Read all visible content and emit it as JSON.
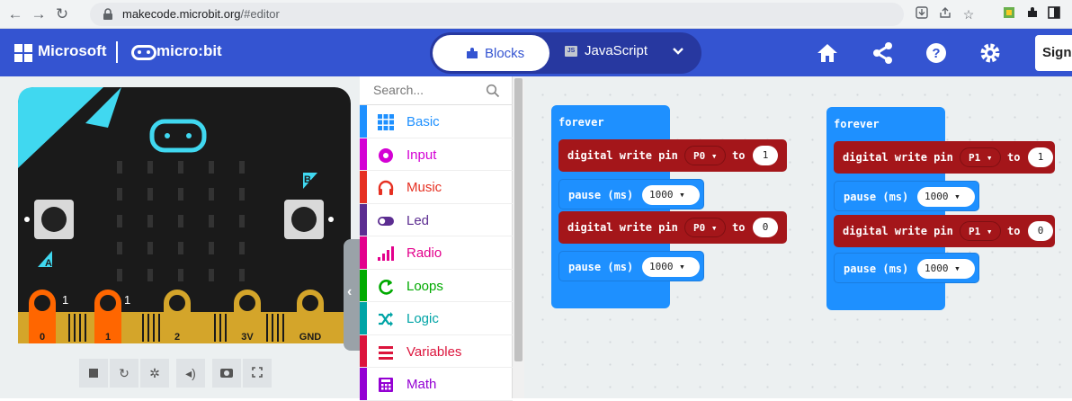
{
  "browser": {
    "url_domain": "makecode.microbit.org",
    "url_path": "/#editor",
    "icons": [
      "back-arrow-icon",
      "forward-arrow-icon",
      "reload-icon",
      "lock-icon",
      "install-icon",
      "share-icon",
      "star-icon",
      "extension-icon",
      "puzzle-icon",
      "sidebar-icon"
    ]
  },
  "header": {
    "brand": "Microsoft",
    "product": "micro:bit",
    "tabs": {
      "blocks": "Blocks",
      "javascript": "JavaScript",
      "js_badge": "JS"
    },
    "icons": [
      "home-icon",
      "share-icon",
      "help-icon",
      "settings-icon"
    ],
    "sign_in": "Sign"
  },
  "simulator": {
    "pins": [
      "0",
      "1",
      "2",
      "3V",
      "GND"
    ],
    "pin_values": [
      "1",
      "1"
    ],
    "button_labels": [
      "A",
      "B"
    ],
    "toolbar_icons": [
      "stop-icon",
      "restart-icon",
      "debug-icon",
      "mute-icon",
      "screenshot-icon",
      "fullscreen-icon"
    ]
  },
  "toolbox": {
    "search_placeholder": "Search...",
    "categories": [
      {
        "label": "Basic",
        "color": "#1e90ff"
      },
      {
        "label": "Input",
        "color": "#d400d4"
      },
      {
        "label": "Music",
        "color": "#e63022"
      },
      {
        "label": "Led",
        "color": "#5c2d91"
      },
      {
        "label": "Radio",
        "color": "#e3008c"
      },
      {
        "label": "Loops",
        "color": "#00aa00"
      },
      {
        "label": "Logic",
        "color": "#00a4a6"
      },
      {
        "label": "Variables",
        "color": "#dc143c"
      },
      {
        "label": "Math",
        "color": "#9400d3"
      }
    ]
  },
  "workspace": {
    "scripts": [
      {
        "event": "forever",
        "blocks": [
          {
            "text": "digital write pin",
            "pin": "P0 ▾",
            "to": "to",
            "value": "1"
          },
          {
            "text": "pause (ms)",
            "value": "1000 ▾"
          },
          {
            "text": "digital write pin",
            "pin": "P0 ▾",
            "to": "to",
            "value": "0"
          },
          {
            "text": "pause (ms)",
            "value": "1000 ▾"
          }
        ]
      },
      {
        "event": "forever",
        "blocks": [
          {
            "text": "digital write pin",
            "pin": "P1 ▾",
            "to": "to",
            "value": "1"
          },
          {
            "text": "pause (ms)",
            "value": "1000 ▾"
          },
          {
            "text": "digital write pin",
            "pin": "P1 ▾",
            "to": "to",
            "value": "0"
          },
          {
            "text": "pause (ms)",
            "value": "1000 ▾"
          }
        ]
      }
    ]
  },
  "colors": {
    "header": "#3454d1",
    "loop_block": "#1e90ff",
    "pin_block": "#a4161a",
    "board": "#1a1a1a",
    "board_accent": "#40d8f0",
    "pin_gold": "#d4a52a",
    "pin_active": "#ff6600"
  }
}
